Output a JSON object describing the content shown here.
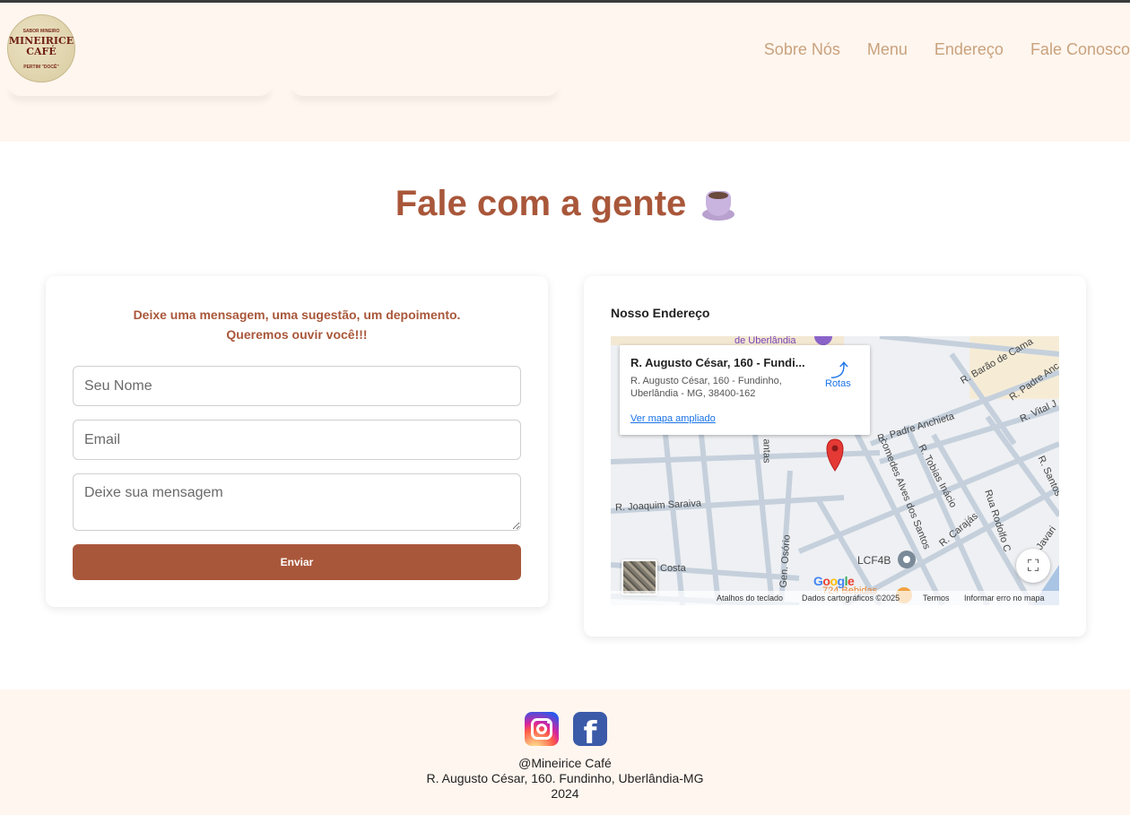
{
  "logo": {
    "top_text": "SABOR MINEIRO",
    "name_line1": "MINEIRICE",
    "name_line2": "CAFÉ",
    "bottom_text": "PERTIM \"DOCÊ\""
  },
  "nav": {
    "items": [
      "Sobre Nós",
      "Menu",
      "Endereço",
      "Fale Conosco"
    ]
  },
  "contact": {
    "title": "Fale com a gente",
    "title_icon": "coffee-cup-icon"
  },
  "form": {
    "intro_line1": "Deixe uma mensagem, uma sugestão, um depoimento.",
    "intro_line2": "Queremos ouvir você!!!",
    "name_placeholder": "Seu Nome",
    "email_placeholder": "Email",
    "message_placeholder": "Deixe sua mensagem",
    "submit_label": "Enviar"
  },
  "map": {
    "section_title": "Nosso Endereço",
    "place_name": "R. Augusto César, 160 - Fundi...",
    "place_address": "R. Augusto César, 160 - Fundinho, Uberlândia - MG, 38400-162",
    "directions_label": "Rotas",
    "view_larger": "Ver mapa ampliado",
    "street_labels": [
      "de Uberlândia",
      "R. Barão de Cama",
      "R. Padre Anc",
      "R. Vital J",
      "R. Padre Anchieta",
      "R. Tobias Inácio",
      "comedes Alves dos Santos",
      "R. Joaquim Saraiva",
      "Rua Rodolfo C",
      "R. Carajás",
      "R. Santos",
      "R. Javari",
      "Gen. Osório",
      "LCF4B",
      "724 Bebidas",
      "Costa",
      "antas"
    ],
    "google_logo": "Google",
    "footer_shortcuts": "Atalhos do teclado",
    "footer_data": "Dados cartográficos ©2025",
    "footer_terms": "Termos",
    "footer_report": "Informar erro no mapa"
  },
  "footer": {
    "handle": "@Mineirice Café",
    "address": "R. Augusto César, 160. Fundinho, Uberlândia-MG",
    "year": "2024"
  },
  "colors": {
    "accent": "#a9573a",
    "nav": "#c9a27d",
    "header_bg": "#fff6ef"
  }
}
